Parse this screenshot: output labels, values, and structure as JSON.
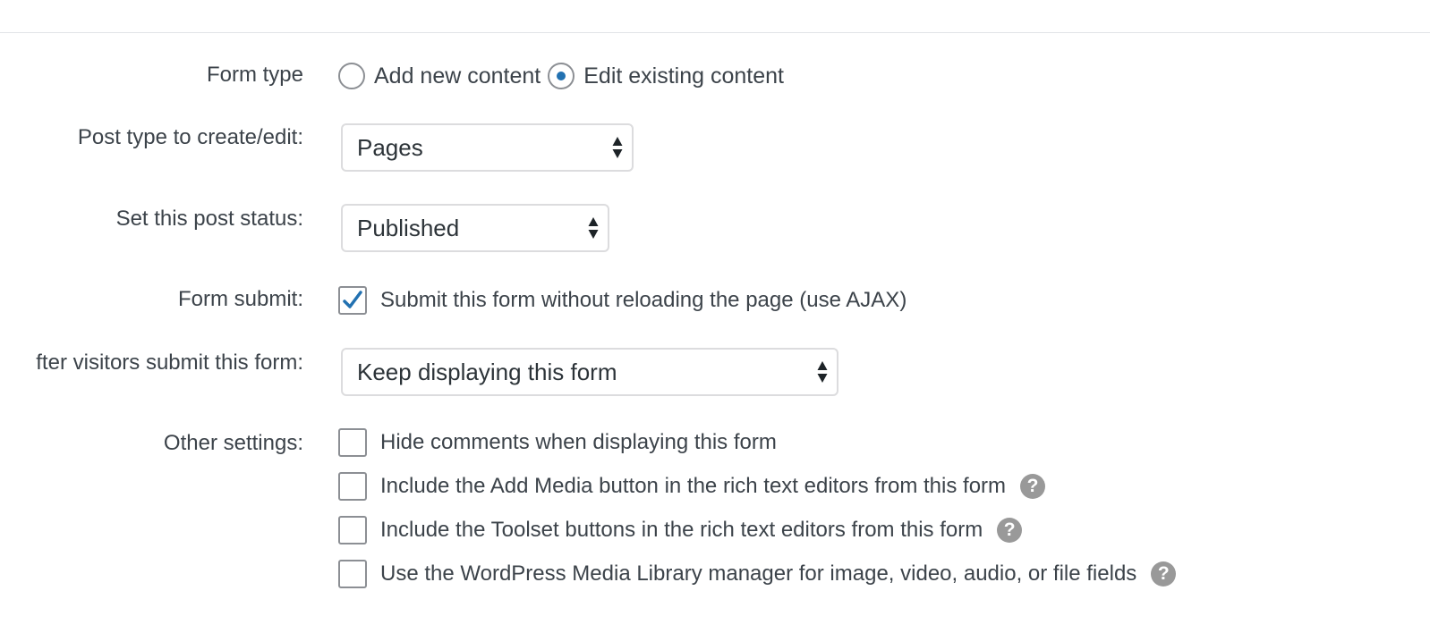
{
  "form_type": {
    "label": "Form type",
    "options": [
      {
        "label": "Add new content",
        "checked": false
      },
      {
        "label": "Edit existing content",
        "checked": true
      }
    ]
  },
  "post_type": {
    "label": "Post type to create/edit:",
    "value": "Pages"
  },
  "post_status": {
    "label": "Set this post status:",
    "value": "Published"
  },
  "form_submit": {
    "label": "Form submit:",
    "checkbox_label": "Submit this form without reloading the page (use AJAX)",
    "checked": true
  },
  "after_submit": {
    "label": "fter visitors submit this form:",
    "value": "Keep displaying this form"
  },
  "other_settings": {
    "label": "Other settings:",
    "items": [
      {
        "label": "Hide comments when displaying this form",
        "checked": false,
        "help": false
      },
      {
        "label": "Include the Add Media button in the rich text editors from this form",
        "checked": false,
        "help": true
      },
      {
        "label": "Include the Toolset buttons in the rich text editors from this form",
        "checked": false,
        "help": true
      },
      {
        "label": "Use the WordPress Media Library manager for image, video, audio, or file fields",
        "checked": false,
        "help": true
      }
    ],
    "help_glyph": "?"
  },
  "colors": {
    "accent": "#2271b1",
    "help_icon": "#999999",
    "border": "#dcdcde"
  }
}
